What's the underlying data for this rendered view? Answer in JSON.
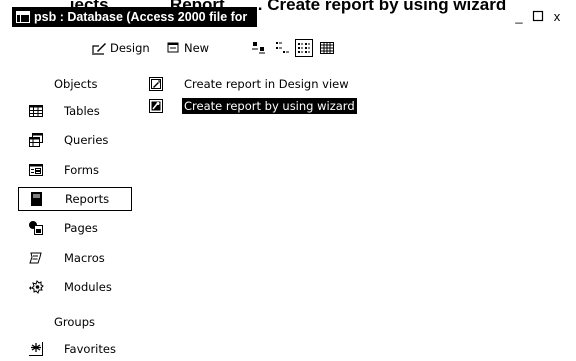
{
  "caption": "jects ...., ..... Report, ...... Create report by using wizard",
  "window": {
    "title": "psb : Database (Access 2000 file for",
    "minimize_label": "_",
    "maximize_label": "□",
    "close_label": "x"
  },
  "toolbar": {
    "design_label": "Design",
    "new_label": "New"
  },
  "objects_header": "Objects",
  "groups_header": "Groups",
  "objects": [
    {
      "label": "Tables",
      "icon": "table-icon"
    },
    {
      "label": "Queries",
      "icon": "query-icon"
    },
    {
      "label": "Forms",
      "icon": "form-icon"
    },
    {
      "label": "Reports",
      "icon": "report-icon",
      "selected": true
    },
    {
      "label": "Pages",
      "icon": "page-icon"
    },
    {
      "label": "Macros",
      "icon": "macro-icon"
    },
    {
      "label": "Modules",
      "icon": "module-icon"
    }
  ],
  "groups": [
    {
      "label": "Favorites",
      "icon": "favorites-icon"
    }
  ],
  "list": [
    {
      "label": "Create report in Design view",
      "icon": "design-view-icon"
    },
    {
      "label": "Create report by using wizard",
      "icon": "wizard-icon",
      "selected": true
    }
  ]
}
